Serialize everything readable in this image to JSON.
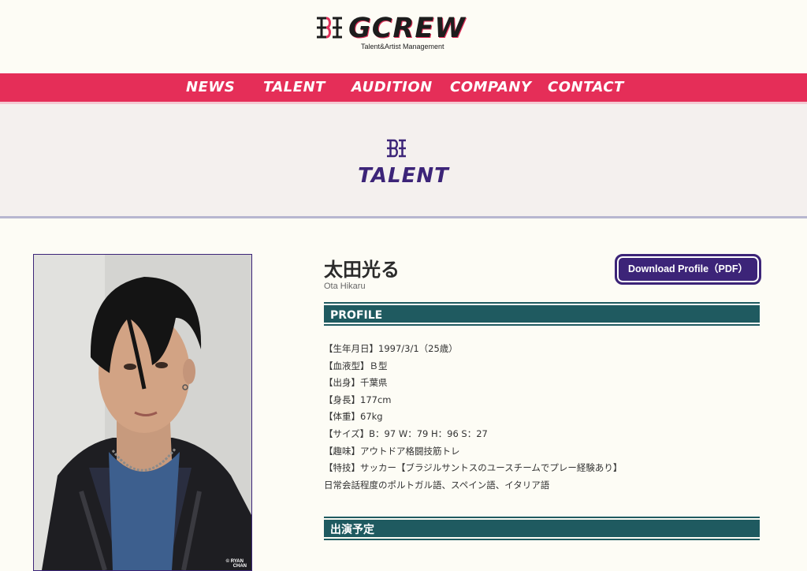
{
  "header": {
    "logo_text": "GCREW",
    "logo_subtitle": "Talent&Artist Management"
  },
  "nav": {
    "items": [
      "NEWS",
      "TALENT",
      "AUDITION",
      "COMPANY",
      "CONTACT"
    ]
  },
  "page": {
    "title": "TALENT"
  },
  "photo": {
    "credit_line1": "© RYAN",
    "credit_line2": "CHAN"
  },
  "profile": {
    "name_jp": "太田光る",
    "name_en": "Ota Hikaru",
    "download_label": "Download Profile（PDF）",
    "section_title": "PROFILE",
    "details": [
      "【生年月日】1997/3/1（25歳）",
      "【血液型】Ｂ型",
      "【出身】千葉県",
      "【身長】177cm",
      "【体重】67kg",
      "【サイズ】B：97 W：79 H：96 S：27",
      "【趣味】アウトドア格闘技筋トレ",
      "【特技】サッカー【ブラジルサントスのユースチームでプレー経験あり】",
      "日常会話程度のポルトガル語、スペイン語、イタリア語"
    ],
    "schedule_title": "出演予定"
  },
  "colors": {
    "background": "#fdfcf5",
    "nav": "#e52e58",
    "accent_purple": "#3c2478",
    "section_teal": "#1f5a60"
  }
}
